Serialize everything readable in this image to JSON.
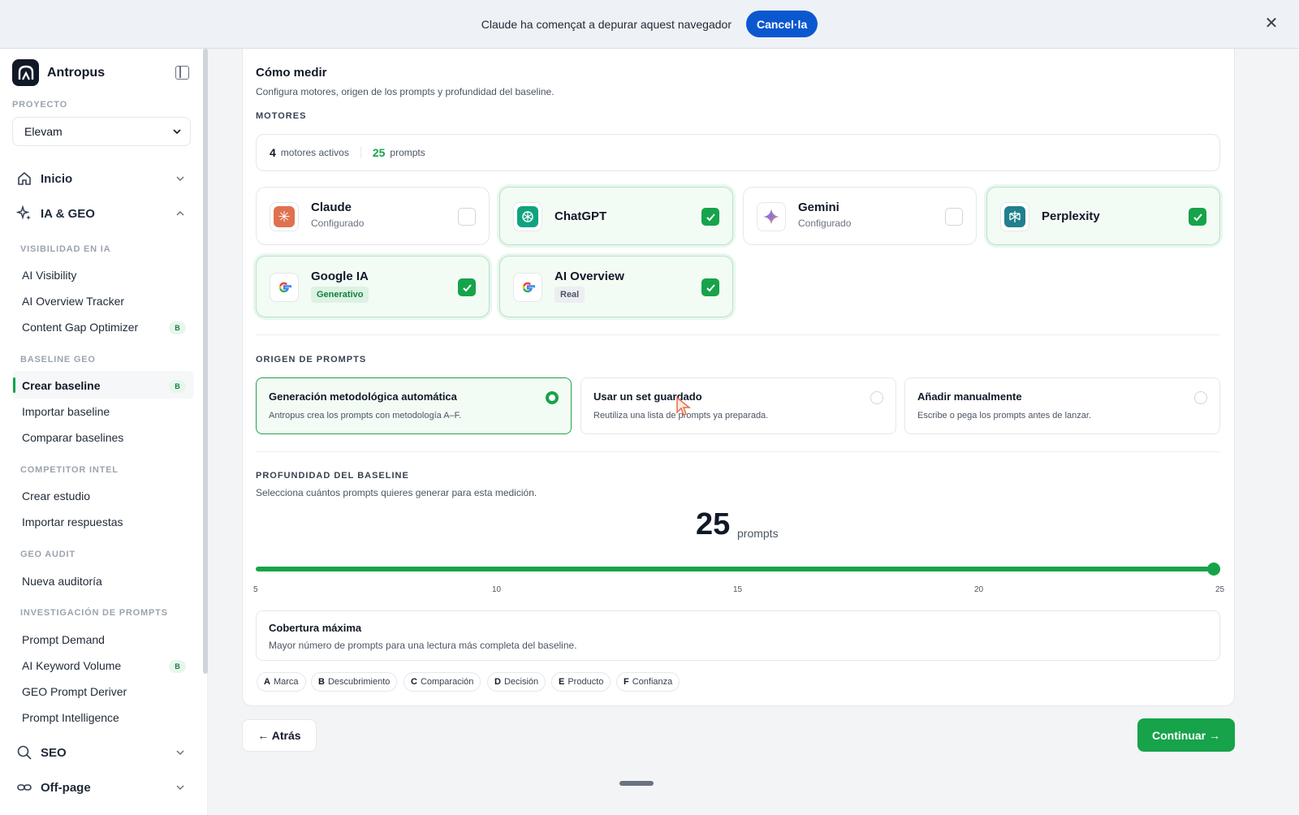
{
  "banner": {
    "text": "Claude ha començat a depurar aquest navegador",
    "cancel_label": "Cancel·la"
  },
  "sidebar": {
    "brand": "Antropus",
    "project_label": "PROYECTO",
    "project_value": "Elevam",
    "inicio": "Inicio",
    "ia_geo": "IA & GEO",
    "groups": {
      "visibilidad": "VISIBILIDAD EN IA",
      "baseline": "BASELINE GEO",
      "competitor": "COMPETITOR INTEL",
      "audit": "GEO AUDIT",
      "prompts": "INVESTIGACIÓN DE PROMPTS"
    },
    "items": {
      "ai_visibility": "AI Visibility",
      "ai_overview_tracker": "AI Overview Tracker",
      "content_gap": "Content Gap Optimizer",
      "crear_baseline": "Crear baseline",
      "importar_baseline": "Importar baseline",
      "comparar_baselines": "Comparar baselines",
      "crear_estudio": "Crear estudio",
      "importar_respuestas": "Importar respuestas",
      "nueva_auditoria": "Nueva auditoría",
      "prompt_demand": "Prompt Demand",
      "ai_keyword_volume": "AI Keyword Volume",
      "geo_prompt_deriver": "GEO Prompt Deriver",
      "prompt_intelligence": "Prompt Intelligence"
    },
    "badge": "B",
    "seo": "SEO",
    "offpage": "Off-page"
  },
  "main": {
    "title": "Cómo medir",
    "subtitle": "Configura motores, origen de los prompts y profundidad del baseline.",
    "motores_label": "MOTORES",
    "summary": {
      "engines_count": "4",
      "engines_text": "motores activos",
      "prompts_count": "25",
      "prompts_text": "prompts"
    },
    "engines": {
      "claude": {
        "name": "Claude",
        "sub": "Configurado",
        "checked": false
      },
      "chatgpt": {
        "name": "ChatGPT",
        "checked": true
      },
      "gemini": {
        "name": "Gemini",
        "sub": "Configurado",
        "checked": false
      },
      "perplexity": {
        "name": "Perplexity",
        "checked": true
      },
      "google_ia": {
        "name": "Google IA",
        "tag": "Generativo",
        "checked": true
      },
      "ai_overview": {
        "name": "AI Overview",
        "tag": "Real",
        "checked": true
      }
    },
    "origin_label": "ORIGEN DE PROMPTS",
    "origins": {
      "auto": {
        "title": "Generación metodológica automática",
        "sub": "Antropus crea los prompts con metodología A–F.",
        "selected": true
      },
      "saved": {
        "title": "Usar un set guardado",
        "sub": "Reutiliza una lista de prompts ya preparada.",
        "selected": false
      },
      "manual": {
        "title": "Añadir manualmente",
        "sub": "Escribe o pega los prompts antes de lanzar.",
        "selected": false
      }
    },
    "depth_label": "PROFUNDIDAD DEL BASELINE",
    "depth_sub": "Selecciona cuántos prompts quieres generar para esta medición.",
    "depth_value": "25",
    "depth_unit": "prompts",
    "slider": {
      "min": 5,
      "max": 25,
      "value": 25,
      "ticks": [
        "5",
        "10",
        "15",
        "20",
        "25"
      ]
    },
    "coverage": {
      "title": "Cobertura máxima",
      "sub": "Mayor número de prompts para una lectura más completa del baseline."
    },
    "chips": [
      {
        "letter": "A",
        "label": "Marca"
      },
      {
        "letter": "B",
        "label": "Descubrimiento"
      },
      {
        "letter": "C",
        "label": "Comparación"
      },
      {
        "letter": "D",
        "label": "Decisión"
      },
      {
        "letter": "E",
        "label": "Producto"
      },
      {
        "letter": "F",
        "label": "Confianza"
      }
    ],
    "back_label": "← Atrás",
    "next_label": "Continuar →"
  },
  "colors": {
    "accent": "#16a34a",
    "banner_button": "#0b57d0"
  }
}
